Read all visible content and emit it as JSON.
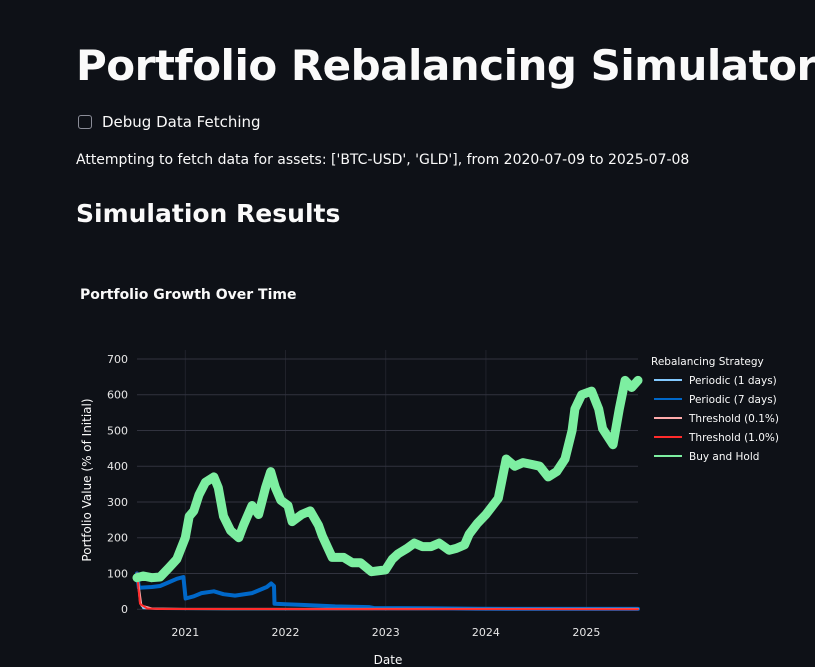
{
  "page": {
    "title": "Portfolio Rebalancing Simulator",
    "debug_checkbox": {
      "label": "Debug Data Fetching",
      "checked": false
    },
    "fetch_message": "Attempting to fetch data for assets: ['BTC-USD', 'GLD'], from 2020-07-09 to 2025-07-08",
    "section_title": "Simulation Results"
  },
  "chart_data": {
    "type": "line",
    "title": "Portfolio Growth Over Time",
    "xlabel": "Date",
    "ylabel": "Portfolio Value (% of Initial)",
    "x_ticks": [
      "2021",
      "2022",
      "2023",
      "2024",
      "2025"
    ],
    "y_ticks": [
      0,
      100,
      200,
      300,
      400,
      500,
      600,
      700
    ],
    "xlim": [
      "2020-07-09",
      "2025-07-08"
    ],
    "ylim": [
      -5,
      725
    ],
    "grid": true,
    "legend": {
      "title": "Rebalancing Strategy",
      "position": "right"
    },
    "series": [
      {
        "name": "Periodic (1 days)",
        "color": "#83c9ff",
        "points": [
          [
            "2020-07-09",
            100
          ],
          [
            "2020-07-20",
            20
          ],
          [
            "2020-08-01",
            3
          ],
          [
            "2020-10-01",
            0.5
          ],
          [
            "2021-06-01",
            0.1
          ],
          [
            "2025-07-08",
            0
          ]
        ]
      },
      {
        "name": "Periodic (7 days)",
        "color": "#0068c9",
        "points": [
          [
            "2020-07-09",
            100
          ],
          [
            "2020-07-16",
            60
          ],
          [
            "2020-09-01",
            62
          ],
          [
            "2020-10-01",
            65
          ],
          [
            "2020-11-01",
            75
          ],
          [
            "2020-12-01",
            85
          ],
          [
            "2020-12-25",
            90
          ],
          [
            "2021-01-02",
            30
          ],
          [
            "2021-02-01",
            36
          ],
          [
            "2021-03-01",
            45
          ],
          [
            "2021-04-15",
            50
          ],
          [
            "2021-05-20",
            42
          ],
          [
            "2021-07-01",
            38
          ],
          [
            "2021-09-01",
            45
          ],
          [
            "2021-10-25",
            62
          ],
          [
            "2021-11-10",
            72
          ],
          [
            "2021-11-20",
            65
          ],
          [
            "2021-11-22",
            15
          ],
          [
            "2022-01-01",
            14
          ],
          [
            "2022-03-01",
            12
          ],
          [
            "2022-05-01",
            10
          ],
          [
            "2022-07-01",
            8
          ],
          [
            "2022-09-01",
            7
          ],
          [
            "2022-11-01",
            6
          ],
          [
            "2022-11-20",
            3
          ],
          [
            "2023-03-01",
            3
          ],
          [
            "2023-06-01",
            2.5
          ],
          [
            "2023-09-01",
            2
          ],
          [
            "2023-12-01",
            1.5
          ],
          [
            "2024-06-01",
            1
          ],
          [
            "2025-07-08",
            1
          ]
        ]
      },
      {
        "name": "Threshold (0.1%)",
        "color": "#ffabab",
        "points": [
          [
            "2020-07-09",
            100
          ],
          [
            "2020-07-25",
            10
          ],
          [
            "2020-09-01",
            2
          ],
          [
            "2021-01-01",
            1
          ],
          [
            "2025-07-08",
            1
          ]
        ]
      },
      {
        "name": "Threshold (1.0%)",
        "color": "#ff2b2b",
        "points": [
          [
            "2020-07-09",
            100
          ],
          [
            "2020-07-20",
            15
          ],
          [
            "2020-08-15",
            2
          ],
          [
            "2020-10-01",
            0.5
          ],
          [
            "2025-07-08",
            0
          ]
        ]
      },
      {
        "name": "Buy and Hold",
        "color": "#7defa1",
        "points": [
          [
            "2020-07-09",
            88
          ],
          [
            "2020-08-01",
            93
          ],
          [
            "2020-09-01",
            88
          ],
          [
            "2020-10-01",
            90
          ],
          [
            "2020-11-01",
            115
          ],
          [
            "2020-12-01",
            140
          ],
          [
            "2021-01-01",
            200
          ],
          [
            "2021-01-15",
            260
          ],
          [
            "2021-02-01",
            275
          ],
          [
            "2021-02-20",
            320
          ],
          [
            "2021-03-15",
            355
          ],
          [
            "2021-04-15",
            370
          ],
          [
            "2021-05-01",
            340
          ],
          [
            "2021-05-20",
            260
          ],
          [
            "2021-06-15",
            220
          ],
          [
            "2021-07-15",
            200
          ],
          [
            "2021-08-01",
            235
          ],
          [
            "2021-09-01",
            290
          ],
          [
            "2021-09-25",
            265
          ],
          [
            "2021-10-20",
            340
          ],
          [
            "2021-11-08",
            385
          ],
          [
            "2021-11-25",
            340
          ],
          [
            "2021-12-15",
            305
          ],
          [
            "2022-01-10",
            290
          ],
          [
            "2022-01-25",
            245
          ],
          [
            "2022-03-01",
            265
          ],
          [
            "2022-04-01",
            275
          ],
          [
            "2022-05-01",
            235
          ],
          [
            "2022-05-15",
            205
          ],
          [
            "2022-06-20",
            145
          ],
          [
            "2022-08-01",
            145
          ],
          [
            "2022-09-01",
            130
          ],
          [
            "2022-10-01",
            130
          ],
          [
            "2022-11-10",
            105
          ],
          [
            "2022-12-31",
            110
          ],
          [
            "2023-01-25",
            140
          ],
          [
            "2023-02-15",
            155
          ],
          [
            "2023-03-20",
            170
          ],
          [
            "2023-04-15",
            185
          ],
          [
            "2023-05-15",
            175
          ],
          [
            "2023-06-15",
            175
          ],
          [
            "2023-07-15",
            185
          ],
          [
            "2023-08-20",
            165
          ],
          [
            "2023-09-15",
            170
          ],
          [
            "2023-10-15",
            180
          ],
          [
            "2023-11-01",
            210
          ],
          [
            "2023-12-01",
            240
          ],
          [
            "2024-01-01",
            265
          ],
          [
            "2024-02-15",
            310
          ],
          [
            "2024-03-15",
            420
          ],
          [
            "2024-04-15",
            400
          ],
          [
            "2024-05-15",
            410
          ],
          [
            "2024-06-15",
            405
          ],
          [
            "2024-07-15",
            400
          ],
          [
            "2024-08-15",
            370
          ],
          [
            "2024-09-15",
            385
          ],
          [
            "2024-10-15",
            420
          ],
          [
            "2024-11-10",
            500
          ],
          [
            "2024-11-20",
            560
          ],
          [
            "2024-12-15",
            600
          ],
          [
            "2025-01-20",
            610
          ],
          [
            "2025-02-15",
            560
          ],
          [
            "2025-03-01",
            505
          ],
          [
            "2025-04-08",
            460
          ],
          [
            "2025-05-01",
            560
          ],
          [
            "2025-05-22",
            640
          ],
          [
            "2025-06-15",
            620
          ],
          [
            "2025-07-08",
            640
          ]
        ]
      }
    ]
  }
}
